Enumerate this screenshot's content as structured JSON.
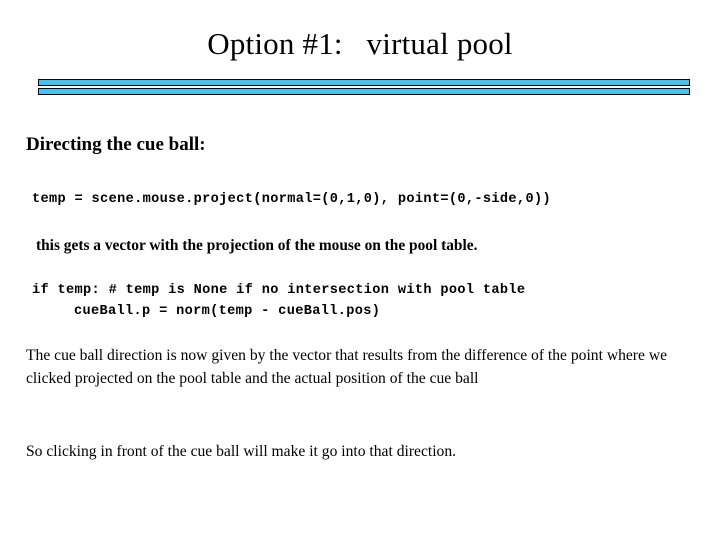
{
  "slide": {
    "title": "Option #1:   virtual pool",
    "accent_color": "#42c3f0",
    "rule_border_color": "#000000",
    "background_color": "#ffffff",
    "text_color": "#000000",
    "heading": "Directing the cue ball:",
    "code_line_1": "temp = scene.mouse.project(normal=(0,1,0), point=(0,-side,0))",
    "note": "this gets a vector with the projection of the mouse on the pool table.",
    "code_line_2": "if temp: # temp is None if no intersection with pool table",
    "code_line_3": "cueBall.p = norm(temp - cueBall.pos)",
    "paragraph_1": "The cue ball direction is now given by the vector that results from the difference of the point where we clicked projected on the pool table and the actual position of the cue ball",
    "paragraph_2": "So clicking in front of the cue ball will make it go into that direction."
  }
}
